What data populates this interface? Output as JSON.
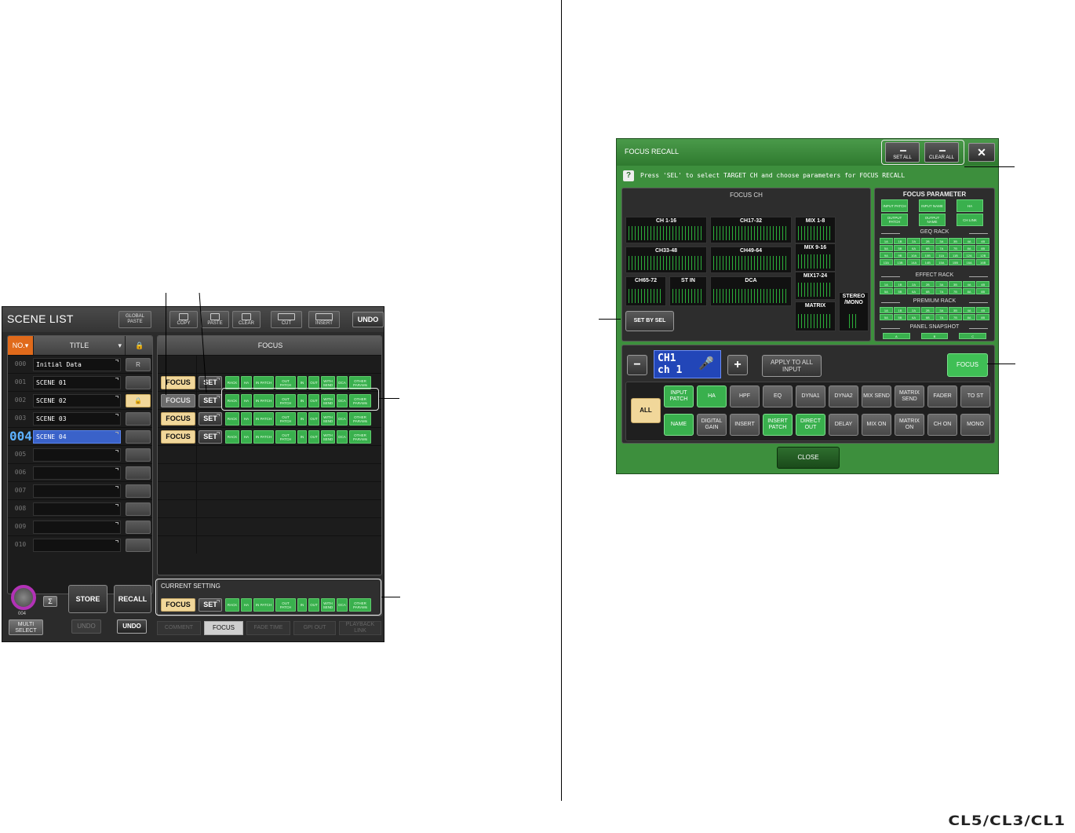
{
  "brand": "CL5/CL3/CL1",
  "scene_list": {
    "title": "SCENE LIST",
    "toolbar": {
      "global_paste": "GLOBAL PASTE",
      "copy": "COPY",
      "paste": "PASTE",
      "clear": "CLEAR",
      "cut": "CUT",
      "insert": "INSERT",
      "undo": "UNDO"
    },
    "headers": {
      "no": "NO.",
      "title": "TITLE",
      "focus": "FOCUS"
    },
    "rows": [
      {
        "no": "000",
        "title": "Initial Data",
        "lock": "R"
      },
      {
        "no": "001",
        "title": "SCENE 01",
        "lock": ""
      },
      {
        "no": "002",
        "title": "SCENE 02",
        "lock": "🔒"
      },
      {
        "no": "003",
        "title": "SCENE 03",
        "lock": ""
      },
      {
        "no": "004",
        "title": "SCENE 04",
        "lock": ""
      },
      {
        "no": "005",
        "title": "",
        "lock": ""
      },
      {
        "no": "006",
        "title": "",
        "lock": ""
      },
      {
        "no": "007",
        "title": "",
        "lock": ""
      },
      {
        "no": "008",
        "title": "",
        "lock": ""
      },
      {
        "no": "009",
        "title": "",
        "lock": ""
      },
      {
        "no": "010",
        "title": "",
        "lock": ""
      }
    ],
    "focus_label": "FOCUS",
    "set_label": "SET",
    "params": [
      "RACK",
      "HA",
      "IN PATCH",
      "OUT PATCH",
      "IN",
      "OUT",
      "WITH SEND",
      "DCA",
      "OTHER PARAMs"
    ],
    "current_setting": "CURRENT SETTING",
    "knob_value": "004",
    "sigma": "Σ",
    "multi_select": "MULTI SELECT",
    "store": "STORE",
    "recall": "RECALL",
    "undo": "UNDO",
    "tabs": [
      "COMMENT",
      "FOCUS",
      "FADE TIME",
      "GPI OUT",
      "PLAYBACK LINK"
    ]
  },
  "focus_recall": {
    "title": "FOCUS RECALL",
    "set_all": "SET ALL",
    "clear_all": "CLEAR ALL",
    "close_x": "✕",
    "help": "?",
    "help_text": "Press 'SEL' to select TARGET CH and choose parameters for FOCUS RECALL",
    "focus_ch_title": "FOCUS CH",
    "groups": [
      "CH 1-16",
      "CH17-32",
      "MIX 1-8",
      "CH33-48",
      "CH49-64",
      "MIX 9-16",
      "CH65-72",
      "ST IN",
      "DCA",
      "MIX17-24",
      "MATRIX",
      "STEREO /MONO"
    ],
    "set_by_sel": "SET BY SEL",
    "focus_param_title": "FOCUS PARAMETER",
    "param_top": [
      "INPUT PATCH",
      "INPUT NAME",
      "HA",
      "OUTPUT PATCH",
      "OUTPUT NAME",
      "CH LINK"
    ],
    "geq_title": "GEQ RACK",
    "geq": [
      "1A",
      "1B",
      "2A",
      "2B",
      "3A",
      "3B",
      "4A",
      "4B",
      "5A",
      "5B",
      "6A",
      "6B",
      "7A",
      "7B",
      "8A",
      "8B",
      "9A",
      "9B",
      "10A",
      "10B",
      "11A",
      "11B",
      "12A",
      "12B",
      "13A",
      "13B",
      "14A",
      "14B",
      "15A",
      "15B",
      "16A",
      "16B"
    ],
    "effect_title": "EFFECT RACK",
    "effect": [
      "1A",
      "1B",
      "2A",
      "2B",
      "3A",
      "3B",
      "4A",
      "4B",
      "5A",
      "5B",
      "6A",
      "6B",
      "7A",
      "7B",
      "8A",
      "8B"
    ],
    "premium_title": "PREMIUM RACK",
    "premium": [
      "1A",
      "1B",
      "2A",
      "2B",
      "3A",
      "3B",
      "4A",
      "4B",
      "5A",
      "5B",
      "6A",
      "6B",
      "7A",
      "7B",
      "8A",
      "8B"
    ],
    "snapshot_title": "PANEL SNAPSHOT",
    "snapshot": [
      "A",
      "B",
      "C"
    ],
    "minus": "−",
    "plus": "+",
    "ch_line1": "CH1",
    "ch_line2": "ch 1",
    "apply": "APPLY TO ALL INPUT",
    "focus": "FOCUS",
    "all": "ALL",
    "params_row1": [
      "INPUT PATCH",
      "HA",
      "HPF",
      "EQ",
      "DYNA1",
      "DYNA2",
      "MIX SEND",
      "MATRIX SEND",
      "FADER",
      "TO ST"
    ],
    "params_row2": [
      "NAME",
      "DIGITAL GAIN",
      "INSERT",
      "INSERT PATCH",
      "DIRECT OUT",
      "DELAY",
      "MIX ON",
      "MATRIX ON",
      "CH ON",
      "MONO"
    ],
    "close": "CLOSE"
  }
}
